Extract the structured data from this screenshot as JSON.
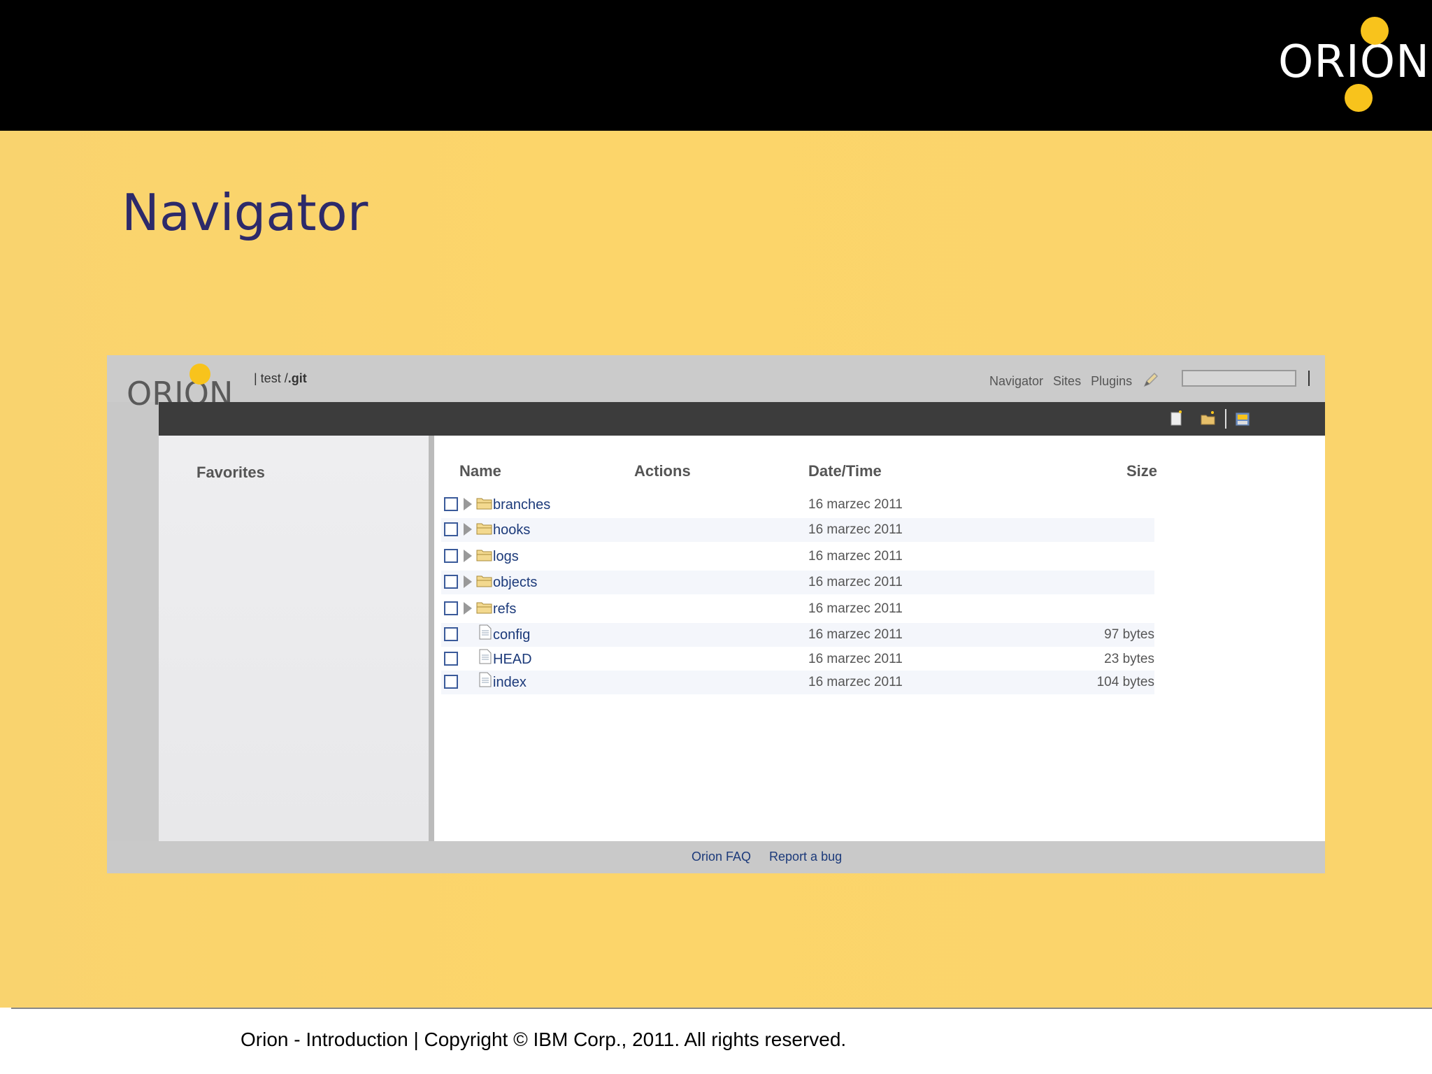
{
  "slide": {
    "title": "Navigator",
    "logo_text": "ORION",
    "footer": "Orion - Introduction | Copyright © IBM Corp., 2011. All rights reserved."
  },
  "app": {
    "logo_text": "ORION",
    "breadcrumb_prefix": "| test /",
    "breadcrumb_current": ".git",
    "nav": [
      "Navigator",
      "Sites",
      "Plugins"
    ],
    "search_value": "",
    "sidebar_title": "Favorites",
    "columns": {
      "name": "Name",
      "actions": "Actions",
      "datetime": "Date/Time",
      "size": "Size"
    },
    "rows": [
      {
        "type": "folder",
        "name": "branches",
        "date": "16 marzec 2011",
        "size": ""
      },
      {
        "type": "folder",
        "name": "hooks",
        "date": "16 marzec 2011",
        "size": ""
      },
      {
        "type": "folder",
        "name": "logs",
        "date": "16 marzec 2011",
        "size": ""
      },
      {
        "type": "folder",
        "name": "objects",
        "date": "16 marzec 2011",
        "size": ""
      },
      {
        "type": "folder",
        "name": "refs",
        "date": "16 marzec 2011",
        "size": ""
      },
      {
        "type": "file",
        "name": "config",
        "date": "16 marzec 2011",
        "size": "97 bytes"
      },
      {
        "type": "file",
        "name": "HEAD",
        "date": "16 marzec 2011",
        "size": "23 bytes"
      },
      {
        "type": "file",
        "name": "index",
        "date": "16 marzec 2011",
        "size": "104 bytes"
      }
    ],
    "footer_links": [
      "Orion FAQ",
      "Report a bug"
    ]
  },
  "colors": {
    "slide_bg": "#fbd46a",
    "accent_yellow": "#f8c31c",
    "title": "#2d2a6a",
    "link": "#1c3a7a"
  }
}
